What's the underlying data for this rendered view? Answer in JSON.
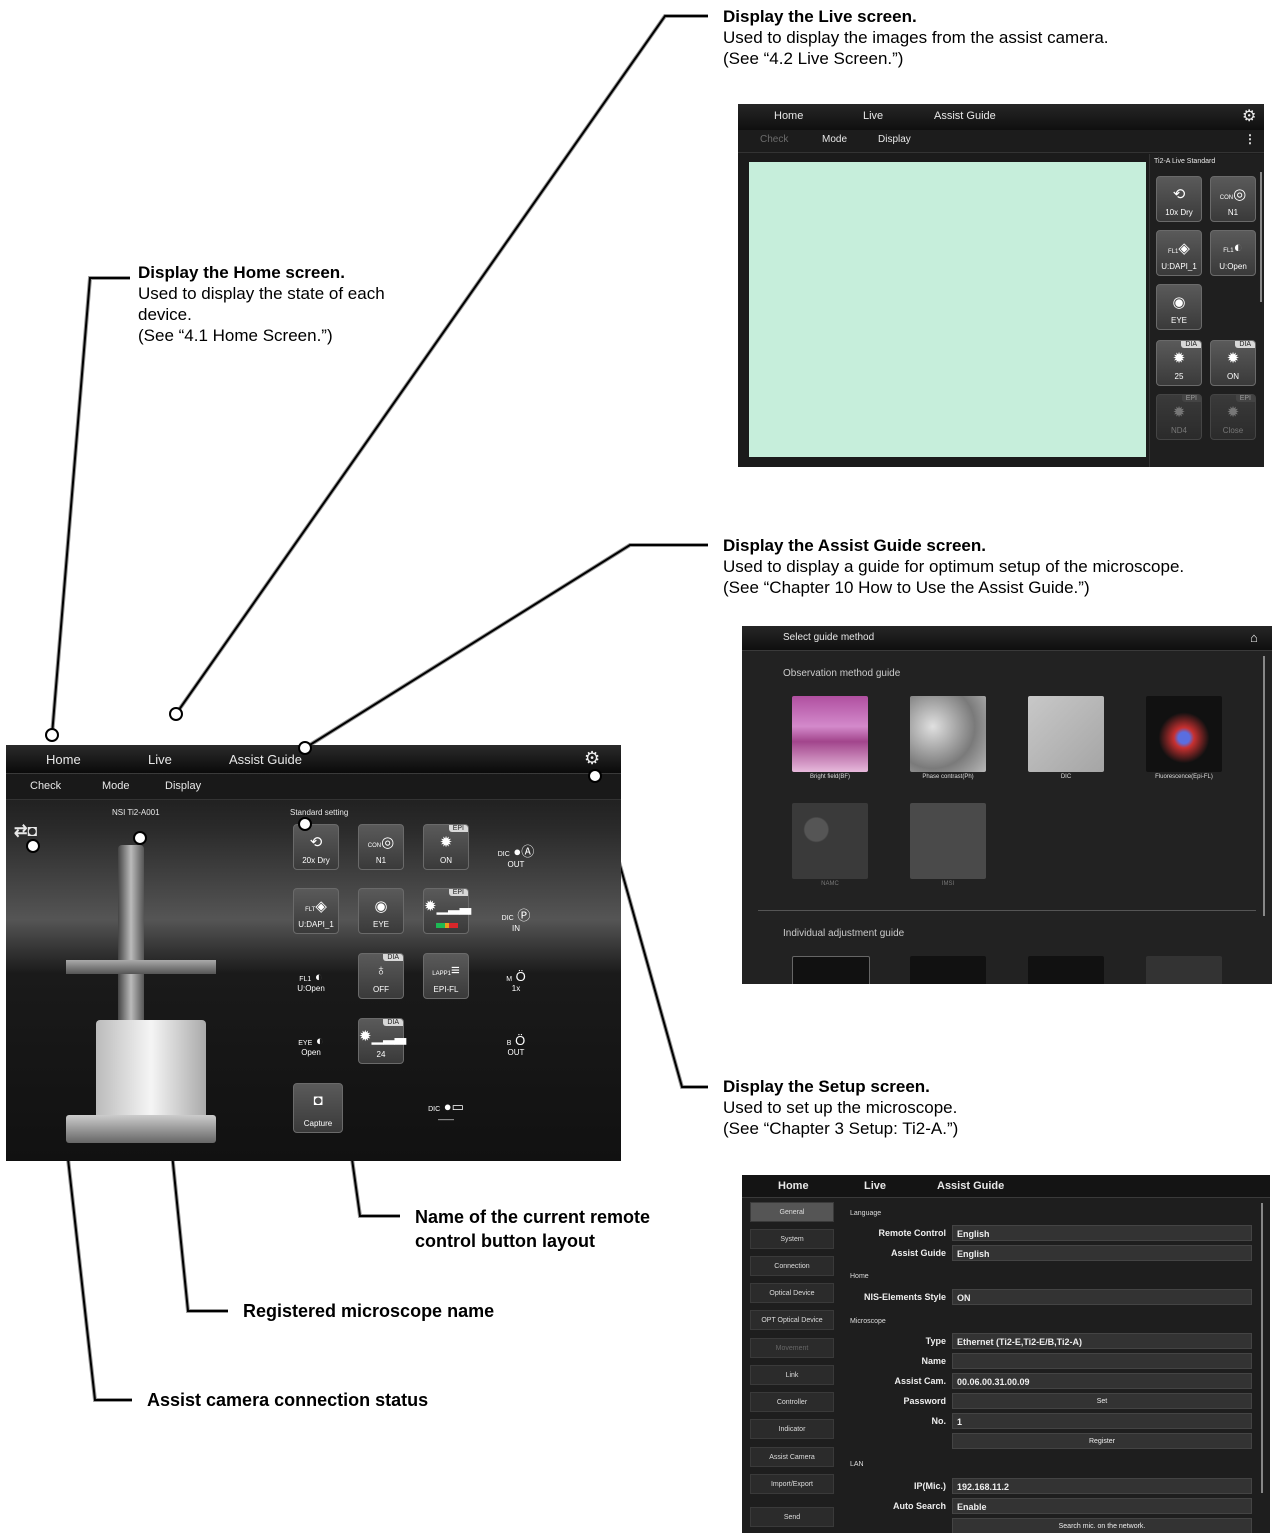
{
  "annotations": {
    "live": {
      "title": "Display the Live screen.",
      "body": "Used to display the images from the assist camera.",
      "ref": "(See “4.2   Live Screen.”)"
    },
    "home": {
      "title": "Display the Home screen.",
      "body1": "Used to display the state of each",
      "body2": "device.",
      "ref": "(See “4.1   Home Screen.”)"
    },
    "assist": {
      "title": "Display the Assist Guide screen.",
      "body": "Used to display a guide for optimum setup of the microscope.",
      "ref": "(See “Chapter 10    How to Use the Assist Guide.”)"
    },
    "setup": {
      "title": "Display the Setup screen.",
      "body": "Used to set up the microscope.",
      "ref": "(See “Chapter 3    Setup: Ti2-A.”)"
    },
    "layout_name1": "Name of the current remote",
    "layout_name2": "control button layout",
    "microscope_name": "Registered microscope name",
    "camera_status": "Assist camera connection status"
  },
  "home_screen": {
    "tabs": [
      "Home",
      "Live",
      "Assist Guide"
    ],
    "subtabs": [
      "Check",
      "Mode",
      "Display"
    ],
    "microscope": "NSI Ti2-A001",
    "layout": "Standard setting",
    "tiles": {
      "obj": {
        "label": "20x Dry",
        "icon": "C"
      },
      "con": {
        "label": "N1",
        "icon": "CON"
      },
      "epi_on": {
        "label": "ON",
        "tag": "EPI"
      },
      "dic_a": {
        "label": "OUT",
        "icon": "DIC"
      },
      "flt": {
        "label": "U:DAPI_1",
        "icon": "FLT"
      },
      "eye": {
        "label": "EYE"
      },
      "epi_nd": {
        "tag": "EPI"
      },
      "dic_p": {
        "label": "IN",
        "icon": "DIC"
      },
      "fl_sh": {
        "label": "U:Open",
        "icon": "FL1"
      },
      "dia_f": {
        "label": "OFF",
        "tag": "DIA"
      },
      "lapp": {
        "label": "EPI-FL",
        "icon": "LAPP1"
      },
      "m": {
        "label": "1x",
        "icon": "M"
      },
      "eye_sh": {
        "label": "Open",
        "icon": "EYE"
      },
      "dia_int": {
        "label": "24",
        "tag": "DIA"
      },
      "b": {
        "label": "OUT",
        "icon": "B"
      },
      "capture": {
        "label": "Capture"
      },
      "dic_bottom": {
        "label": "——",
        "icon": "DIC"
      }
    }
  },
  "live_screen": {
    "tabs": [
      "Home",
      "Live",
      "Assist Guide"
    ],
    "subtabs": [
      "Check",
      "Mode",
      "Display"
    ],
    "panel_title": "Ti2-A Live Standard",
    "tiles": [
      "10x Dry",
      "N1",
      "U:DAPI_1",
      "U:Open",
      "EYE",
      "25",
      "ON",
      "ND4",
      "Close"
    ],
    "tags": [
      "DIA",
      "DIA",
      "EPI",
      "EPI"
    ],
    "con_icon": "CON",
    "fl_icon1": "FL1",
    "fl_icon2": "FL1",
    "live_color": "#c6eedb"
  },
  "assist_screen": {
    "title": "Select guide method",
    "section1": "Observation method guide",
    "section2": "Individual adjustment guide",
    "thumbs": [
      "Bright field(BF)",
      "Phase contrast(Ph)",
      "DIC",
      "Fluorescence(Epi-FL)",
      "NAMC",
      "IMSI"
    ]
  },
  "setup_screen": {
    "tabs": [
      "Home",
      "Live",
      "Assist Guide"
    ],
    "nav": [
      "General",
      "System",
      "Connection",
      "Optical Device",
      "OPT Optical Device",
      "Movement",
      "Link",
      "Controller",
      "Indicator",
      "Assist Camera",
      "Import/Export"
    ],
    "send": "Send",
    "sections": {
      "language": "Language",
      "home": "Home",
      "microscope": "Microscope",
      "lan": "LAN"
    },
    "rows": {
      "remote": {
        "label": "Remote Control",
        "value": "English"
      },
      "assist": {
        "label": "Assist Guide",
        "value": "English"
      },
      "nis": {
        "label": "NIS-Elements Style",
        "value": "ON"
      },
      "type": {
        "label": "Type",
        "value": "Ethernet (Ti2-E,Ti2-E/B,Ti2-A)"
      },
      "name": {
        "label": "Name",
        "value": ""
      },
      "cam": {
        "label": "Assist Cam.",
        "value": "00.06.00.31.00.09"
      },
      "password": {
        "label": "Password",
        "value": "Set"
      },
      "no": {
        "label": "No.",
        "value": "1"
      },
      "register": "Register",
      "ip": {
        "label": "IP(Mic.)",
        "value": "192.168.11.2"
      },
      "auto": {
        "label": "Auto Search",
        "value": "Enable"
      },
      "search": "Search mic. on the network."
    }
  }
}
